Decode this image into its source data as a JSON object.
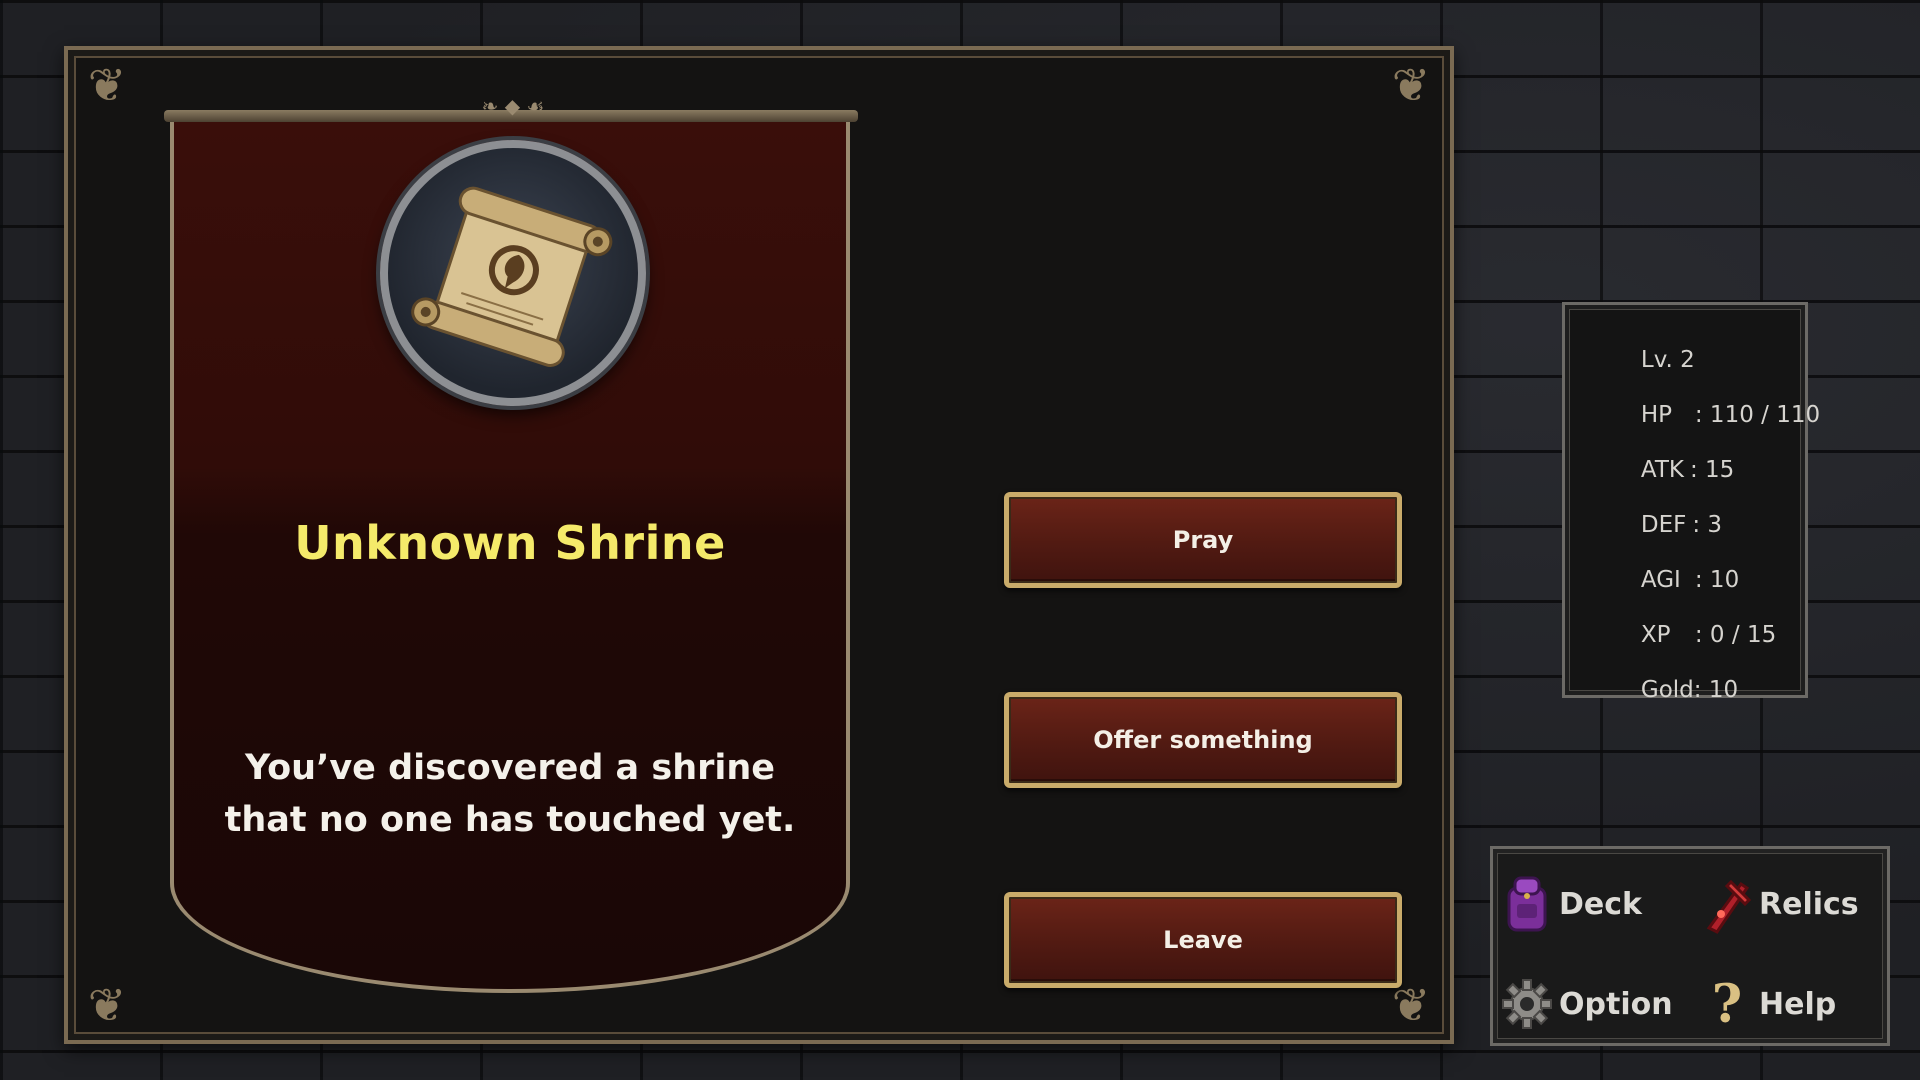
{
  "event": {
    "title": "Unknown Shrine",
    "description": "You’ve discovered a shrine that no one has touched yet.",
    "image_icon": "scroll-icon"
  },
  "choices": [
    {
      "label": "Pray"
    },
    {
      "label": "Offer something"
    },
    {
      "label": "Leave"
    }
  ],
  "stats": {
    "level": "Lv. 2",
    "hp_label": "HP",
    "hp_value": ": 110 / 110",
    "atk_label": "ATK",
    "atk_value": ": 15",
    "def_label": "DEF",
    "def_value": ": 3",
    "agi_label": "AGI",
    "agi_value": ": 10",
    "xp_label": "XP",
    "xp_value": ": 0 / 15",
    "gold_label": "Gold",
    "gold_value": ": 10"
  },
  "menu": {
    "deck": {
      "label": "Deck",
      "icon": "backpack-icon"
    },
    "relics": {
      "label": "Relics",
      "icon": "relic-icon"
    },
    "option": {
      "label": "Option",
      "icon": "gear-icon"
    },
    "help": {
      "label": "Help",
      "icon": "question-icon"
    }
  },
  "colors": {
    "title": "#f5ea6a",
    "button_border": "#c9ab6a",
    "button_fill": "#511a12",
    "card_fill": "#300c08"
  }
}
